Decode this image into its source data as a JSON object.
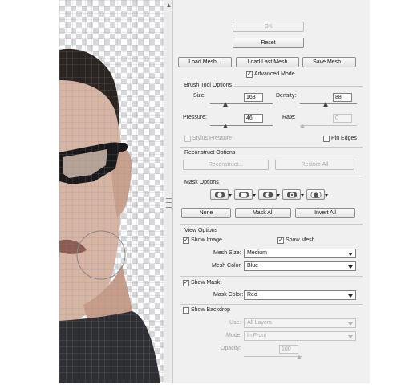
{
  "dialog": {
    "ok_label": "OK",
    "reset_label": "Reset",
    "load_mesh_label": "Load Mesh...",
    "load_last_mesh_label": "Load Last Mesh",
    "save_mesh_label": "Save Mesh...",
    "advanced_mode_label": "Advanced Mode",
    "advanced_mode_checked": true
  },
  "brush_tool_options": {
    "heading": "Brush Tool Options",
    "size_label": "Size:",
    "size_value": "163",
    "size_slider_fraction": 0.22,
    "density_label": "Density:",
    "density_value": "88",
    "density_slider_fraction": 0.45,
    "pressure_label": "Pressure:",
    "pressure_value": "46",
    "pressure_slider_fraction": 0.22,
    "rate_label": "Rate:",
    "rate_value": "0",
    "rate_slider_fraction": 0.0,
    "stylus_pressure_label": "Stylus Pressure",
    "stylus_pressure_checked": false,
    "pin_edges_label": "Pin Edges",
    "pin_edges_checked": false
  },
  "reconstruct_options": {
    "heading": "Reconstruct Options",
    "reconstruct_label": "Reconstruct...",
    "restore_all_label": "Restore All"
  },
  "mask_options": {
    "heading": "Mask Options",
    "buttons": [
      "replace-selection-icon",
      "add-to-selection-icon",
      "subtract-from-selection-icon",
      "intersect-with-selection-icon",
      "invert-selection-icon"
    ],
    "none_label": "None",
    "mask_all_label": "Mask All",
    "invert_all_label": "Invert All"
  },
  "view_options": {
    "heading": "View Options",
    "show_image_label": "Show Image",
    "show_image_checked": true,
    "show_mesh_label": "Show Mesh",
    "show_mesh_checked": true,
    "mesh_size_label": "Mesh Size:",
    "mesh_size_value": "Medium",
    "mesh_color_label": "Mesh Color:",
    "mesh_color_value": "Blue",
    "show_mask_label": "Show Mask",
    "show_mask_checked": true,
    "mask_color_label": "Mask Color:",
    "mask_color_value": "Red",
    "show_backdrop_label": "Show Backdrop",
    "show_backdrop_checked": false,
    "use_label": "Use:",
    "use_value": "All Layers",
    "mode_label": "Mode:",
    "mode_value": "In Front",
    "opacity_label": "Opacity:",
    "opacity_value": "100",
    "opacity_slider_fraction": 1.0
  },
  "colors": {
    "panel_bg": "#f0f0f0",
    "mesh_line": "#7d8fa6",
    "checker": "#d8d8d8"
  }
}
